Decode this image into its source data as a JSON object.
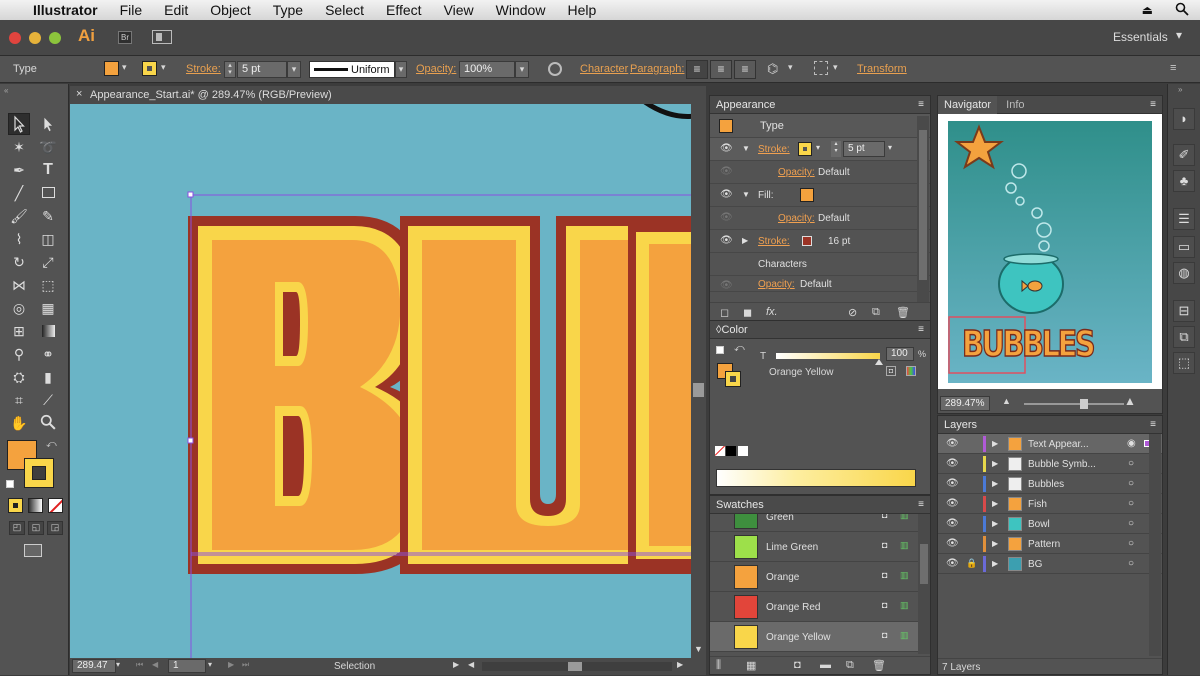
{
  "menubar": {
    "app_name": "Illustrator",
    "items": [
      "File",
      "Edit",
      "Object",
      "Type",
      "Select",
      "Effect",
      "View",
      "Window",
      "Help"
    ]
  },
  "appbar": {
    "logo": "Ai",
    "bridge": "Br",
    "workspace": "Essentials"
  },
  "control_bar": {
    "selection_type": "Type",
    "stroke_label": "Stroke:",
    "stroke_value": "5 pt",
    "profile": "Uniform",
    "opacity_label": "Opacity:",
    "opacity_value": "100%",
    "character_label": "Character",
    "paragraph_label": "Paragraph:",
    "transform_label": "Transform"
  },
  "document": {
    "tab_title": "Appearance_Start.ai* @ 289.47% (RGB/Preview)",
    "zoom": "289.47",
    "artboard": "1",
    "status": "Selection",
    "canvas_text": "BUBBLES"
  },
  "appearance_panel": {
    "title": "Appearance",
    "object_type": "Type",
    "rows": [
      {
        "name": "stroke1",
        "label": "Stroke:",
        "value": "5 pt"
      },
      {
        "name": "opacity1",
        "label": "Opacity:",
        "value": "Default"
      },
      {
        "name": "fill",
        "label": "Fill:"
      },
      {
        "name": "opacity2",
        "label": "Opacity:",
        "value": "Default"
      },
      {
        "name": "stroke2",
        "label": "Stroke:",
        "value": "16 pt"
      },
      {
        "name": "characters",
        "label": "Characters"
      },
      {
        "name": "opacity3",
        "label": "Opacity:",
        "value": "Default"
      }
    ]
  },
  "color_panel": {
    "title": "Color",
    "channel": "T",
    "value": "100",
    "unit": "%",
    "color_name": "Orange Yellow"
  },
  "swatches_panel": {
    "title": "Swatches",
    "items": [
      {
        "name": "Green",
        "color": "#3e8f3e"
      },
      {
        "name": "Lime Green",
        "color": "#9de04a"
      },
      {
        "name": "Orange",
        "color": "#f4a23e"
      },
      {
        "name": "Orange Red",
        "color": "#e2453a"
      },
      {
        "name": "Orange Yellow",
        "color": "#f9d64a"
      }
    ]
  },
  "navigator_panel": {
    "tabs": [
      "Navigator",
      "Info"
    ],
    "zoom": "289.47%",
    "preview_text": "BUBBLES"
  },
  "layers_panel": {
    "title": "Layers",
    "layers": [
      {
        "name": "Text Appear...",
        "color": "#b05ad8"
      },
      {
        "name": "Bubble Symb...",
        "color": "#e6d84a"
      },
      {
        "name": "Bubbles",
        "color": "#4a7ad8"
      },
      {
        "name": "Fish",
        "color": "#d84a4a"
      },
      {
        "name": "Bowl",
        "color": "#4a7ad8"
      },
      {
        "name": "Pattern",
        "color": "#e0903a"
      },
      {
        "name": "BG",
        "color": "#6a6ad8"
      }
    ],
    "count": "7 Layers"
  },
  "colors": {
    "orange": "#f4a23e",
    "yellow": "#f9d64a",
    "dark_red": "#9b3325",
    "canvas_bg": "#6ab4c6",
    "accent_link": "#f0a050"
  }
}
